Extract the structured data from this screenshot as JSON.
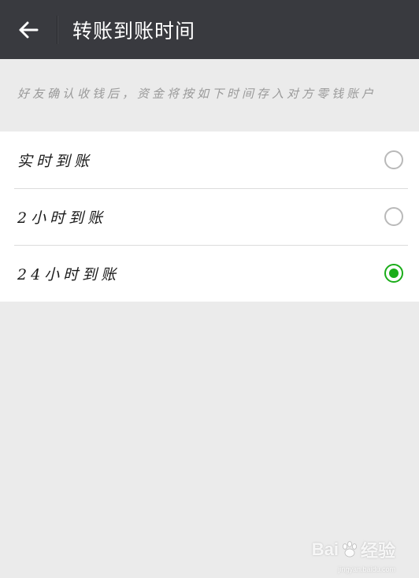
{
  "header": {
    "title": "转账到账时间",
    "back_icon": "arrow-left-icon"
  },
  "notice": {
    "text": "好友确认收钱后，资金将按如下时间存入对方零钱账户"
  },
  "options": [
    {
      "label": "实时到账",
      "selected": false
    },
    {
      "label": "2小时到账",
      "selected": false
    },
    {
      "label": "24小时到账",
      "selected": true
    }
  ],
  "colors": {
    "header_bg": "#393a3f",
    "accent": "#1aad19",
    "page_bg": "#ebebeb"
  },
  "watermark": {
    "brand_left": "Bai",
    "brand_right": "经验",
    "url": "jingyan.baidu.com"
  }
}
